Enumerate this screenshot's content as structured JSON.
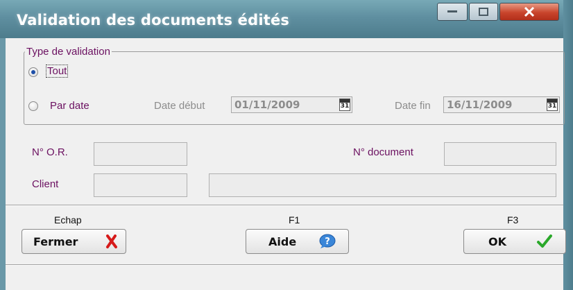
{
  "window": {
    "title": "Validation des documents édités",
    "controls": [
      "minimize-icon",
      "maximize-icon",
      "close-icon"
    ]
  },
  "validation_group": {
    "legend": "Type de validation",
    "options": [
      {
        "label": "Tout",
        "selected": true
      },
      {
        "label": "Par date",
        "selected": false
      }
    ],
    "date_start": {
      "label": "Date début",
      "value": "01/11/2009",
      "calendar_day": "31"
    },
    "date_end": {
      "label": "Date fin",
      "value": "16/11/2009",
      "calendar_day": "31"
    }
  },
  "fields": {
    "or_label": "N° O.R.",
    "or_value": "",
    "document_label": "N° document",
    "document_value": "",
    "client_label": "Client",
    "client_code": "",
    "client_name": ""
  },
  "buttons": {
    "close": {
      "key": "Echap",
      "label": "Fermer",
      "icon": "red-x-icon"
    },
    "help": {
      "key": "F1",
      "label": "Aide",
      "icon": "help-bubble-icon"
    },
    "ok": {
      "key": "F3",
      "label": "OK",
      "icon": "green-check-icon"
    }
  },
  "colors": {
    "titlebar": "#5f8fa0",
    "label_text": "#6b1060",
    "close_button": "#c9452c",
    "check": "#2aa82a"
  }
}
